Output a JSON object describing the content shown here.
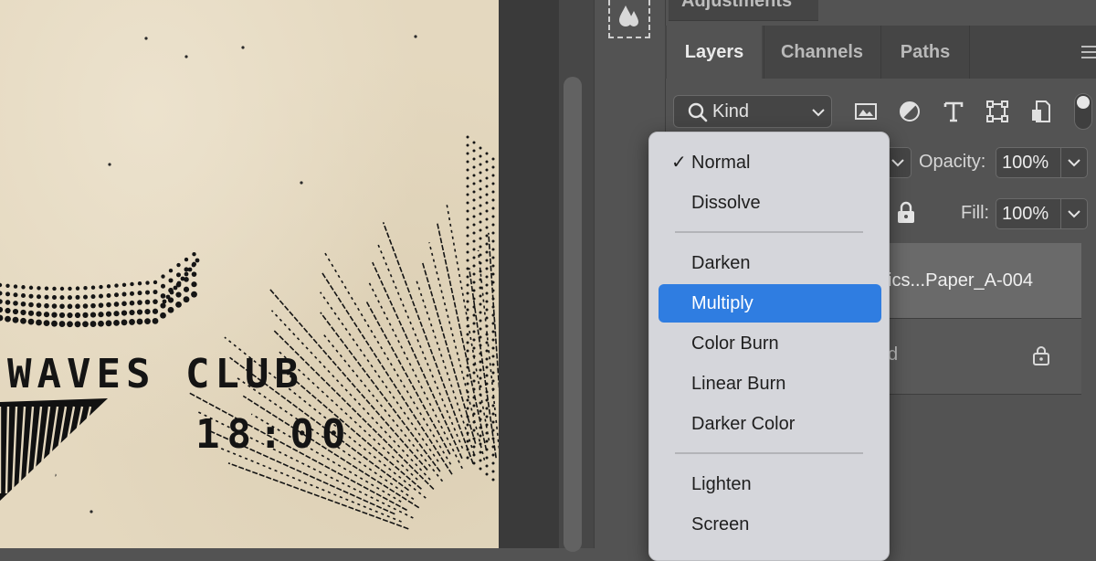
{
  "poster": {
    "title": "WAVES CLUB",
    "time": "18:00"
  },
  "panel": {
    "adjustments_tab": "Adjustments",
    "tabs": [
      {
        "label": "Layers",
        "active": true
      },
      {
        "label": "Channels",
        "active": false
      },
      {
        "label": "Paths",
        "active": false
      }
    ],
    "filter": {
      "kind_label": "Kind",
      "icons": [
        "image-filter-icon",
        "adjustment-filter-icon",
        "type-filter-icon",
        "shape-filter-icon",
        "smart-object-filter-icon"
      ]
    },
    "opacity_label": "Opacity:",
    "opacity_value": "100%",
    "fill_label": "Fill:",
    "fill_value": "100%",
    "layers": [
      {
        "name": "ics...Paper_A-004",
        "selected": true
      },
      {
        "name": "d",
        "locked": true
      }
    ]
  },
  "blend_menu": {
    "checked": "Normal",
    "highlighted": "Multiply",
    "groups": [
      [
        "Normal",
        "Dissolve"
      ],
      [
        "Darken",
        "Multiply",
        "Color Burn",
        "Linear Burn",
        "Darker Color"
      ],
      [
        "Lighten",
        "Screen"
      ]
    ],
    "check_glyph": "✓"
  },
  "colors": {
    "panel_bg": "#535353",
    "menu_bg": "#d5d6db",
    "highlight": "#2f7de1",
    "paper": "#e4d8bf"
  }
}
